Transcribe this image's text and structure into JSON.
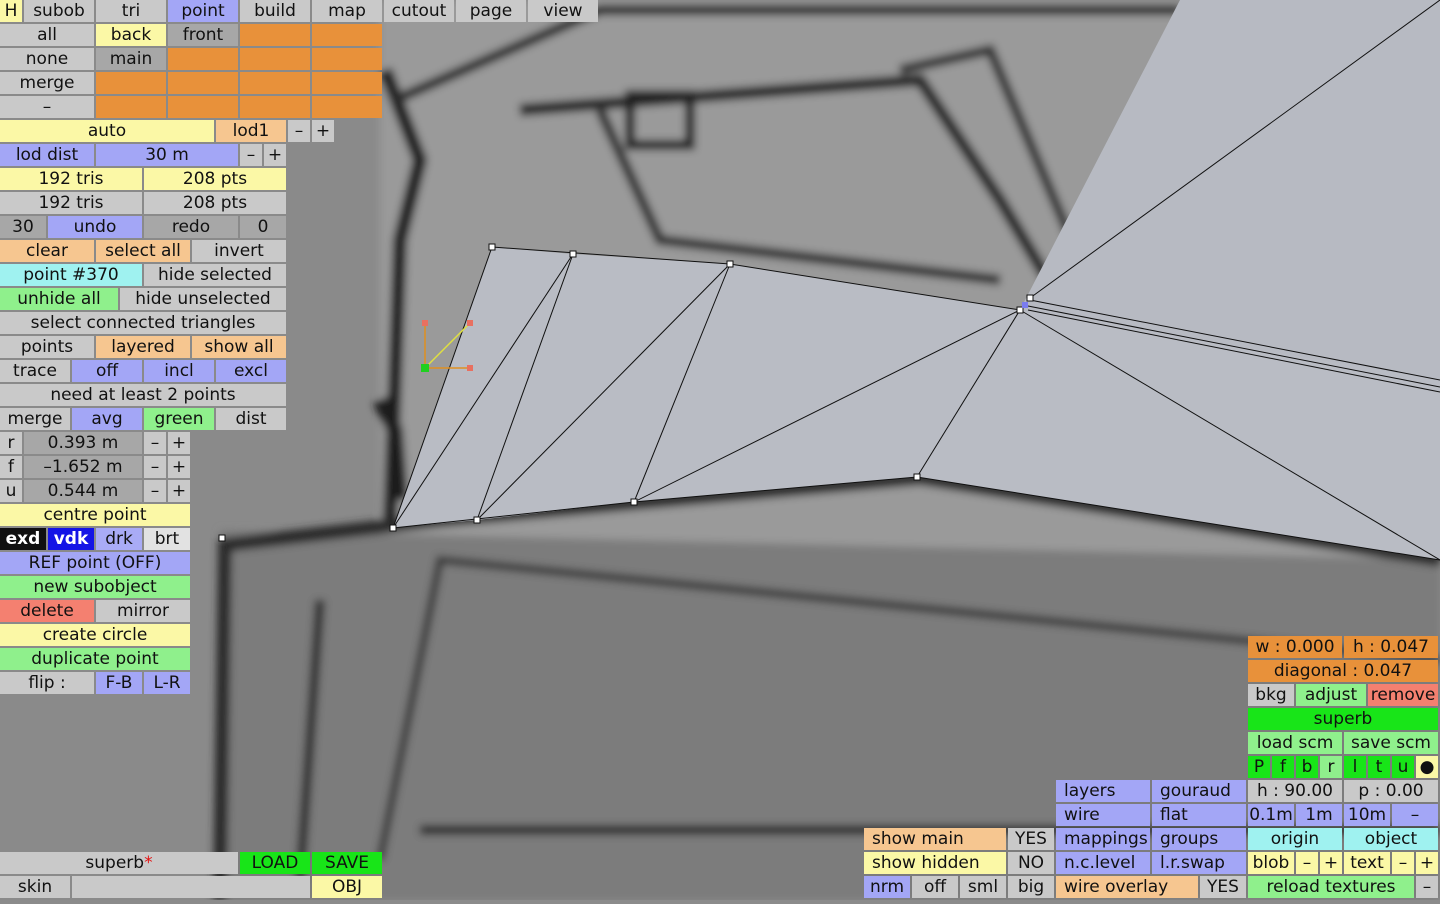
{
  "app": {
    "menu": {
      "h": "H",
      "subob": "subob",
      "tri": "tri",
      "point": "point",
      "build": "build",
      "map": "map",
      "cutout": "cutout",
      "page": "page",
      "view": "view"
    },
    "select_grid": {
      "all": "all",
      "back": "back",
      "front": "front",
      "none": "none",
      "main": "main",
      "merge": "merge",
      "dash": "–"
    },
    "lod": {
      "auto": "auto",
      "lod1": "lod1",
      "minus": "–",
      "plus": "+",
      "lod_dist": "lod dist",
      "dist_value": "30 m"
    },
    "counts": {
      "tris_a": "192 tris",
      "pts_a": "208 pts",
      "tris_b": "192 tris",
      "pts_b": "208 pts"
    },
    "history": {
      "n": "30",
      "undo": "undo",
      "redo": "redo",
      "zero": "0"
    },
    "select_ops": {
      "clear": "clear",
      "select_all": "select all",
      "invert": "invert",
      "point": "point #370",
      "hide_selected": "hide selected",
      "unhide_all": "unhide all",
      "hide_unselected": "hide unselected",
      "select_connected": "select connected triangles"
    },
    "display": {
      "points": "points",
      "layered": "layered",
      "show_all": "show all",
      "trace": "trace",
      "off": "off",
      "incl": "incl",
      "excl": "excl"
    },
    "merge": {
      "msg": "need at least 2 points",
      "merge": "merge",
      "avg": "avg",
      "green": "green",
      "dist": "dist"
    },
    "coords": [
      {
        "axis": "r",
        "value": "0.393 m",
        "minus": "–",
        "plus": "+"
      },
      {
        "axis": "f",
        "value": "–1.652 m",
        "minus": "–",
        "plus": "+"
      },
      {
        "axis": "u",
        "value": "0.544 m",
        "minus": "–",
        "plus": "+"
      }
    ],
    "ops": {
      "centre": "centre point",
      "exd": "exd",
      "vdk": "vdk",
      "drk": "drk",
      "brt": "brt",
      "ref": "REF point (OFF)",
      "new_sub": "new subobject",
      "delete": "delete",
      "mirror": "mirror",
      "circle": "create circle",
      "duplicate": "duplicate point",
      "flip": "flip :",
      "fb": "F-B",
      "lr": "L-R"
    },
    "file": {
      "name": "superb",
      "modified": "*",
      "load": "LOAD",
      "save": "SAVE",
      "skin": "skin",
      "obj": "OBJ"
    },
    "show": {
      "show_main": "show main",
      "yes": "YES",
      "show_hidden": "show hidden",
      "no": "NO",
      "nrm": "nrm",
      "off": "off",
      "sml": "sml",
      "big": "big"
    },
    "render": {
      "layers": "layers",
      "gouraud": "gouraud",
      "wire": "wire",
      "flat": "flat",
      "mappings": "mappings",
      "groups": "groups",
      "nclevel": "n.c.level",
      "lrswap": "l.r.swap",
      "wire_overlay": "wire overlay",
      "yes": "YES"
    },
    "bkg": {
      "w": "w : 0.000",
      "h": "h : 0.047",
      "diagonal": "diagonal : 0.047",
      "bkg": "bkg",
      "adjust": "adjust",
      "remove": "remove",
      "superb": "superb",
      "load_scm": "load scm",
      "save_scm": "save scm",
      "views": [
        "P",
        "f",
        "b",
        "r",
        "l",
        "t",
        "u",
        "●"
      ],
      "heading": "h : 90.00",
      "pitch": "p : 0.00",
      "s01": "0.1m",
      "s1": "1m",
      "s10": "10m",
      "dash": "–",
      "origin": "origin",
      "object": "object",
      "blob": "blob",
      "minus": "–",
      "plus": "+",
      "text": "text",
      "reload": "reload textures"
    }
  }
}
